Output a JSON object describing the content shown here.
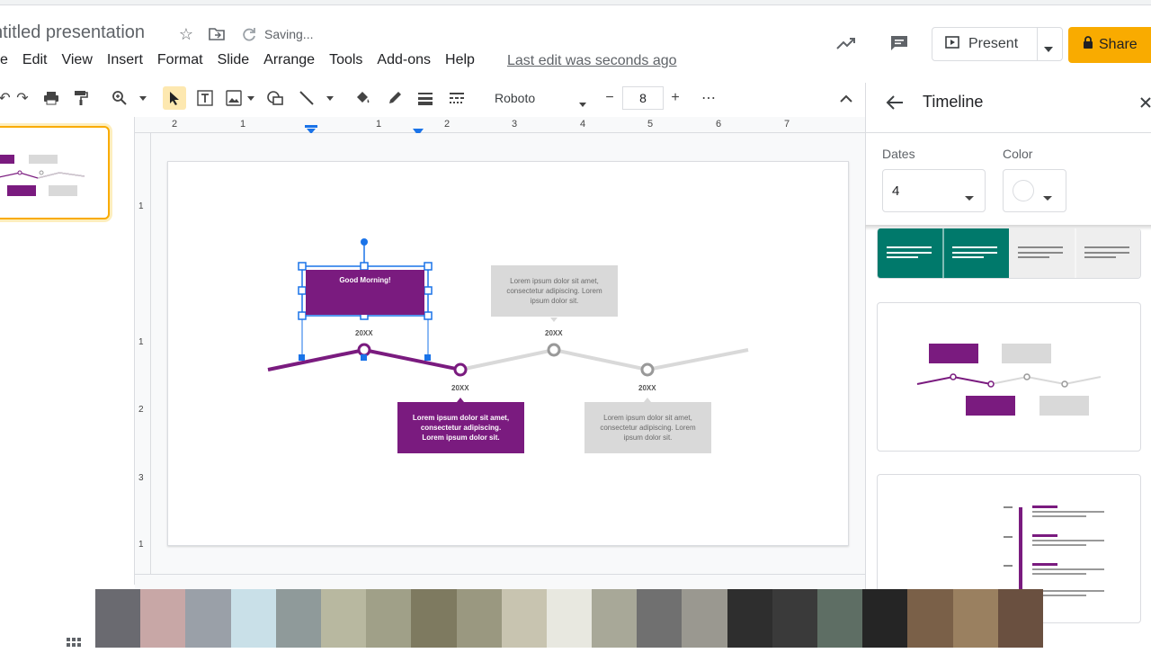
{
  "header": {
    "title": "ntitled presentation",
    "saving": "Saving...",
    "last_edit": "Last edit was seconds ago",
    "present_label": "Present",
    "share_label": "Share"
  },
  "menu": [
    "e",
    "Edit",
    "View",
    "Insert",
    "Format",
    "Slide",
    "Arrange",
    "Tools",
    "Add-ons",
    "Help"
  ],
  "toolbar": {
    "font": "Roboto",
    "font_size": "8",
    "minus": "−",
    "plus": "+",
    "more": "⋯"
  },
  "ruler": {
    "top": [
      "2",
      "1",
      "1",
      "2",
      "3",
      "4",
      "5",
      "6",
      "7"
    ],
    "left": [
      "1",
      "1",
      "2",
      "3",
      "1"
    ]
  },
  "slide": {
    "box_good_morning": "Good Morning!",
    "box_top_gray": "Lorem ipsum dolor sit amet, consectetur adipiscing. Lorem ipsum dolor sit.",
    "box_bottom_purple": "Lorem ipsum dolor sit amet, consectetur adipiscing. Lorem ipsum dolor sit.",
    "box_bottom_gray": "Lorem ipsum dolor sit amet, consectetur adipiscing. Lorem ipsum dolor sit.",
    "years": [
      "20XX",
      "20XX",
      "20XX",
      "20XX"
    ]
  },
  "side_panel": {
    "title": "Timeline",
    "dates_label": "Dates",
    "dates_value": "4",
    "color_label": "Color"
  },
  "colors": {
    "accent_purple": "#7a1b7f",
    "timeline_gray": "#d9d9d9",
    "share_yellow": "#f9ab00",
    "teal": "#00796b"
  },
  "icons": [
    "star-icon",
    "folder-move-icon",
    "sync-icon",
    "trend-icon",
    "comment-icon",
    "present-icon",
    "lock-icon",
    "back-arrow-icon",
    "close-icon"
  ]
}
